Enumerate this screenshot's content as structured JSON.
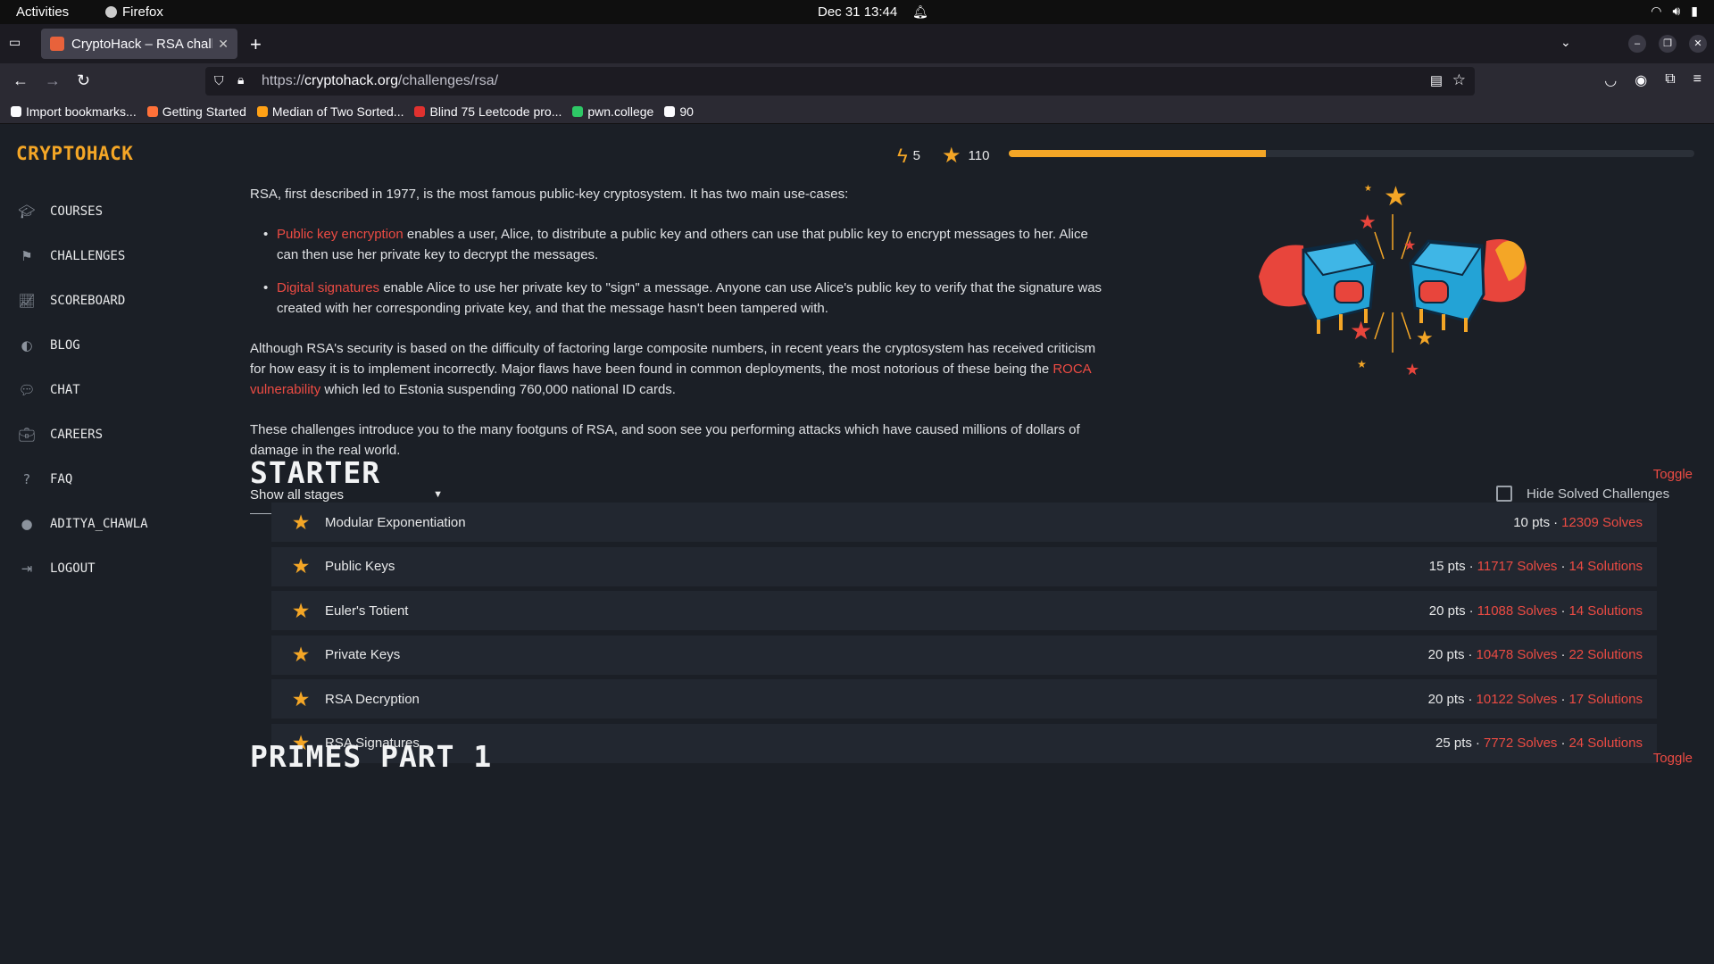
{
  "os": {
    "activities": "Activities",
    "app_name": "Firefox",
    "clock": "Dec 31  13:44"
  },
  "browser": {
    "tab_title": "CryptoHack – RSA challe",
    "url_prefix": "https://",
    "url_host": "cryptohack.org",
    "url_path": "/challenges/rsa/",
    "bookmarks": [
      {
        "label": "Import bookmarks...",
        "icon": "import-icon",
        "color": "#fbfbfe"
      },
      {
        "label": "Getting Started",
        "icon": "firefox-icon",
        "color": "#ff7139"
      },
      {
        "label": "Median of Two Sorted...",
        "icon": "leetcode-icon",
        "color": "#ffa116"
      },
      {
        "label": "Blind 75 Leetcode pro...",
        "icon": "tuf-icon",
        "color": "#e0312f"
      },
      {
        "label": "pwn.college",
        "icon": "pwn-college-icon",
        "color": "#2ec866"
      },
      {
        "label": "90",
        "icon": "github-icon",
        "color": "#fbfbfe"
      }
    ]
  },
  "site": {
    "logo": "CRYPTOHACK",
    "accent": "#f4a626",
    "link_color": "#ec4b43",
    "nav": [
      {
        "label": "COURSES",
        "icon": "graduation-cap-icon"
      },
      {
        "label": "CHALLENGES",
        "icon": "flag-icon"
      },
      {
        "label": "SCOREBOARD",
        "icon": "chart-line-icon"
      },
      {
        "label": "BLOG",
        "icon": "brain-icon"
      },
      {
        "label": "CHAT",
        "icon": "chat-bubbles-icon"
      },
      {
        "label": "CAREERS",
        "icon": "briefcase-icon"
      },
      {
        "label": "FAQ",
        "icon": "question-icon"
      },
      {
        "label": "ADITYA_CHAWLA",
        "icon": "user-circle-icon"
      },
      {
        "label": "LOGOUT",
        "icon": "logout-icon"
      }
    ],
    "stats": {
      "streak": "5",
      "score": "110",
      "progress_fraction": 0.375
    }
  },
  "intro": {
    "p1": "RSA, first described in 1977, is the most famous public-key cryptosystem. It has two main use-cases:",
    "b1_link": "Public key encryption",
    "b1_text": " enables a user, Alice, to distribute a public key and others can use that public key to encrypt messages to her. Alice can then use her private key to decrypt the messages.",
    "b2_link": "Digital signatures",
    "b2_text": " enable Alice to use her private key to \"sign\" a message. Anyone can use Alice's public key to verify that the signature was created with her corresponding private key, and that the message hasn't been tampered with.",
    "p2_a": "Although RSA's security is based on the difficulty of factoring large composite numbers, in recent years the cryptosystem has received criticism for how easy it is to implement incorrectly. Major flaws have been found in common deployments, the most notorious of these being the ",
    "p2_link": "ROCA vulnerability",
    "p2_b": " which led to Estonia suspending 760,000 national ID cards.",
    "p3": "These challenges introduce you to the many footguns of RSA, and soon see you performing attacks which have caused millions of dollars of damage in the real world."
  },
  "controls": {
    "stage_select": "Show all stages",
    "hide_solved": "Hide Solved Challenges"
  },
  "sections": [
    {
      "title": "STARTER",
      "toggle": "Toggle",
      "challenges": [
        {
          "name": "Modular Exponentiation",
          "pts": "10 pts",
          "solves": "12309 Solves",
          "solutions": ""
        },
        {
          "name": "Public Keys",
          "pts": "15 pts",
          "solves": "11717 Solves",
          "solutions": "14 Solutions"
        },
        {
          "name": "Euler's Totient",
          "pts": "20 pts",
          "solves": "11088 Solves",
          "solutions": "14 Solutions"
        },
        {
          "name": "Private Keys",
          "pts": "20 pts",
          "solves": "10478 Solves",
          "solutions": "22 Solutions"
        },
        {
          "name": "RSA Decryption",
          "pts": "20 pts",
          "solves": "10122 Solves",
          "solutions": "17 Solutions"
        },
        {
          "name": "RSA Signatures",
          "pts": "25 pts",
          "solves": "7772 Solves",
          "solutions": "24 Solutions"
        }
      ]
    },
    {
      "title": "PRIMES PART 1",
      "toggle": "Toggle",
      "challenges": []
    }
  ],
  "separator": " · "
}
